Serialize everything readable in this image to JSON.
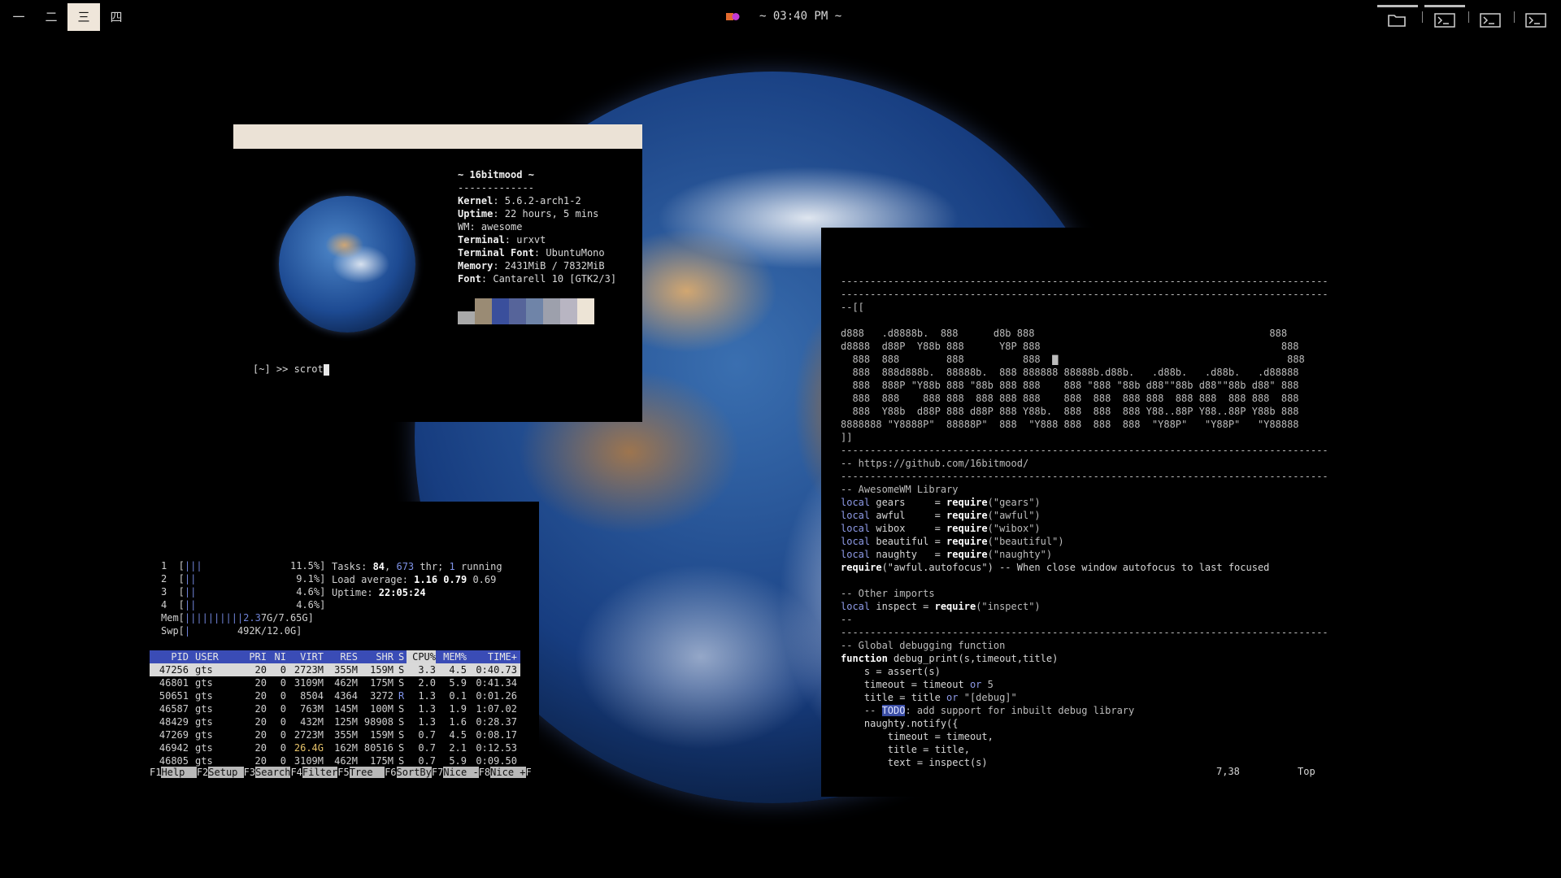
{
  "topbar": {
    "tags": [
      {
        "label": "一",
        "active": false
      },
      {
        "label": "二",
        "active": false
      },
      {
        "label": "三",
        "active": true
      },
      {
        "label": "四",
        "active": false
      }
    ],
    "clock": "~ 03:40 PM ~",
    "tasks": [
      "folder-icon",
      "terminal-icon",
      "terminal-icon",
      "terminal-icon"
    ],
    "colors": {
      "active_tag_bg": "#efe6da",
      "bar_bg": "#000000"
    }
  },
  "fetch": {
    "title": "~ 16bitmood ~",
    "rule": "-------------",
    "rows": [
      {
        "key": "Kernel",
        "value": ": 5.6.2-arch1-2"
      },
      {
        "key": "Uptime",
        "value": ": 22 hours, 5 mins"
      },
      {
        "key": "WM",
        "value": ": awesome"
      },
      {
        "key": "Terminal",
        "value": ": urxvt"
      },
      {
        "key": "Terminal Font",
        "value": ": UbuntuMono"
      },
      {
        "key": "Memory",
        "value": ": 2431MiB / 7832MiB"
      },
      {
        "key": "Font",
        "value": ": Cantarell 10 [GTK2/3]"
      }
    ],
    "palette": [
      "#a9a9a9",
      "#9a8b74",
      "#3a4f9c",
      "#56649a",
      "#6f84a8",
      "#9da0ac",
      "#b8b5c2",
      "#ede4d6"
    ],
    "prompt": "[~] >> scrot"
  },
  "htop": {
    "meters": [
      {
        "label": "1  [",
        "bar": "|||",
        "value": "11.5%]"
      },
      {
        "label": "2  [",
        "bar": "||",
        "value": "9.1%]"
      },
      {
        "label": "3  [",
        "bar": "||",
        "value": "4.6%]"
      },
      {
        "label": "4  [",
        "bar": "||",
        "value": "4.6%]"
      },
      {
        "label": "Mem[",
        "bar": "||||||||||2.3",
        "value": "7G/7.65G]"
      },
      {
        "label": "Swp[",
        "bar": "|",
        "value": "492K/12.0G]"
      }
    ],
    "tasks_label": "Tasks: ",
    "tasks": "84",
    "thr": "673",
    "thr_label": " thr; ",
    "running": "1",
    "running_label": " running",
    "load_label": "Load average: ",
    "load1": "1.16",
    "load5": "0.79",
    "load15": "0.69",
    "uptime_label": "Uptime: ",
    "uptime": "22:05:24",
    "columns": [
      "PID",
      "USER",
      "PRI",
      "NI",
      "VIRT",
      "RES",
      "SHR",
      "S",
      "CPU%",
      "MEM%",
      "TIME+"
    ],
    "processes": [
      {
        "pid": "47256",
        "user": "gts",
        "pri": "20",
        "ni": "0",
        "virt": "2723M",
        "res": "355M",
        "shr": "159M",
        "s": "S",
        "cpu": "3.3",
        "mem": "4.5",
        "time": "0:40.73"
      },
      {
        "pid": "46801",
        "user": "gts",
        "pri": "20",
        "ni": "0",
        "virt": "3109M",
        "res": "462M",
        "shr": "175M",
        "s": "S",
        "cpu": "2.0",
        "mem": "5.9",
        "time": "0:41.34"
      },
      {
        "pid": "50651",
        "user": "gts",
        "pri": "20",
        "ni": "0",
        "virt": "8504",
        "res": "4364",
        "shr": "3272",
        "s": "R",
        "cpu": "1.3",
        "mem": "0.1",
        "time": "0:01.26"
      },
      {
        "pid": "46587",
        "user": "gts",
        "pri": "20",
        "ni": "0",
        "virt": "763M",
        "res": "145M",
        "shr": "100M",
        "s": "S",
        "cpu": "1.3",
        "mem": "1.9",
        "time": "1:07.02"
      },
      {
        "pid": "48429",
        "user": "gts",
        "pri": "20",
        "ni": "0",
        "virt": "432M",
        "res": "125M",
        "shr": "98908",
        "s": "S",
        "cpu": "1.3",
        "mem": "1.6",
        "time": "0:28.37"
      },
      {
        "pid": "47269",
        "user": "gts",
        "pri": "20",
        "ni": "0",
        "virt": "2723M",
        "res": "355M",
        "shr": "159M",
        "s": "S",
        "cpu": "0.7",
        "mem": "4.5",
        "time": "0:08.17"
      },
      {
        "pid": "46942",
        "user": "gts",
        "pri": "20",
        "ni": "0",
        "virt": "26.4G",
        "res": "162M",
        "shr": "80516",
        "s": "S",
        "cpu": "0.7",
        "mem": "2.1",
        "time": "0:12.53"
      },
      {
        "pid": "46805",
        "user": "gts",
        "pri": "20",
        "ni": "0",
        "virt": "3109M",
        "res": "462M",
        "shr": "175M",
        "s": "S",
        "cpu": "0.7",
        "mem": "5.9",
        "time": "0:09.50"
      }
    ],
    "fkeys": [
      {
        "key": "F1",
        "label": "Help  "
      },
      {
        "key": "F2",
        "label": "Setup "
      },
      {
        "key": "F3",
        "label": "Search"
      },
      {
        "key": "F4",
        "label": "Filter"
      },
      {
        "key": "F5",
        "label": "Tree  "
      },
      {
        "key": "F6",
        "label": "SortBy"
      },
      {
        "key": "F7",
        "label": "Nice -"
      },
      {
        "key": "F8",
        "label": "Nice +"
      },
      {
        "key": "F",
        "label": ""
      }
    ]
  },
  "vim": {
    "lines": [
      {
        "segs": [
          {
            "t": "-----------------------------------------------------------------------------------",
            "c": "cm"
          }
        ]
      },
      {
        "segs": [
          {
            "t": "-----------------------------------------------------------------------------------",
            "c": "cm"
          }
        ]
      },
      {
        "segs": [
          {
            "t": "--[[",
            "c": "cm"
          }
        ]
      },
      {
        "segs": [
          {
            "t": "",
            "c": ""
          }
        ]
      },
      {
        "segs": [
          {
            "t": "d888   .d8888b.  888      d8b 888                                        888",
            "c": "cm"
          }
        ]
      },
      {
        "segs": [
          {
            "t": "d8888  d88P  Y88b 888      Y8P 888                                         888",
            "c": "cm"
          }
        ]
      },
      {
        "segs": [
          {
            "t": "  888  888        888          888  ",
            "c": "cm"
          },
          {
            "t": "▇",
            "c": "cm"
          },
          {
            "t": "                                       888",
            "c": "cm"
          }
        ]
      },
      {
        "segs": [
          {
            "t": "  888  888d888b.  88888b.  888 888888 88888b.d88b.   .d88b.   .d88b.   .d88888",
            "c": "cm"
          }
        ]
      },
      {
        "segs": [
          {
            "t": "  888  888P \"Y88b 888 \"88b 888 888    888 \"888 \"88b d88\"\"88b d88\"\"88b d88\" 888",
            "c": "cm"
          }
        ]
      },
      {
        "segs": [
          {
            "t": "  888  888    888 888  888 888 888    888  888  888 888  888 888  888 888  888",
            "c": "cm"
          }
        ]
      },
      {
        "segs": [
          {
            "t": "  888  Y88b  d88P 888 d88P 888 Y88b.  888  888  888 Y88..88P Y88..88P Y88b 888",
            "c": "cm"
          }
        ]
      },
      {
        "segs": [
          {
            "t": "8888888 \"Y8888P\"  88888P\"  888  \"Y888 888  888  888  \"Y88P\"   \"Y88P\"   \"Y88888",
            "c": "cm"
          }
        ]
      },
      {
        "segs": [
          {
            "t": "]]",
            "c": "cm"
          }
        ]
      },
      {
        "segs": [
          {
            "t": "-----------------------------------------------------------------------------------",
            "c": "cm"
          }
        ]
      },
      {
        "segs": [
          {
            "t": "-- https://github.com/16bitmood/",
            "c": "cm"
          }
        ]
      },
      {
        "segs": [
          {
            "t": "-----------------------------------------------------------------------------------",
            "c": "cm"
          }
        ]
      },
      {
        "segs": [
          {
            "t": "-- AwesomeWM Library",
            "c": "cm"
          }
        ]
      },
      {
        "segs": [
          {
            "t": "local",
            "c": "kw"
          },
          {
            "t": " gears     = ",
            "c": ""
          },
          {
            "t": "require",
            "c": "fn"
          },
          {
            "t": "(\"gears\")",
            "c": "str"
          }
        ]
      },
      {
        "segs": [
          {
            "t": "local",
            "c": "kw"
          },
          {
            "t": " awful     = ",
            "c": ""
          },
          {
            "t": "require",
            "c": "fn"
          },
          {
            "t": "(\"awful\")",
            "c": "str"
          }
        ]
      },
      {
        "segs": [
          {
            "t": "local",
            "c": "kw"
          },
          {
            "t": " wibox     = ",
            "c": ""
          },
          {
            "t": "require",
            "c": "fn"
          },
          {
            "t": "(\"wibox\")",
            "c": "str"
          }
        ]
      },
      {
        "segs": [
          {
            "t": "local",
            "c": "kw"
          },
          {
            "t": " beautiful = ",
            "c": ""
          },
          {
            "t": "require",
            "c": "fn"
          },
          {
            "t": "(\"beautiful\")",
            "c": "str"
          }
        ]
      },
      {
        "segs": [
          {
            "t": "local",
            "c": "kw"
          },
          {
            "t": " naughty   = ",
            "c": ""
          },
          {
            "t": "require",
            "c": "fn"
          },
          {
            "t": "(\"naughty\")",
            "c": "str"
          }
        ]
      },
      {
        "segs": [
          {
            "t": "require",
            "c": "fn"
          },
          {
            "t": "(\"awful.autofocus\") -- When close window autofocus to last focused",
            "c": ""
          }
        ]
      },
      {
        "segs": [
          {
            "t": "",
            "c": ""
          }
        ]
      },
      {
        "segs": [
          {
            "t": "-- Other imports",
            "c": "cm"
          }
        ]
      },
      {
        "segs": [
          {
            "t": "local",
            "c": "kw"
          },
          {
            "t": " inspect = ",
            "c": ""
          },
          {
            "t": "require",
            "c": "fn"
          },
          {
            "t": "(\"inspect\")",
            "c": "str"
          }
        ]
      },
      {
        "segs": [
          {
            "t": "--",
            "c": "cm"
          }
        ]
      },
      {
        "segs": [
          {
            "t": "-----------------------------------------------------------------------------------",
            "c": "cm"
          }
        ]
      },
      {
        "segs": [
          {
            "t": "-- Global debugging function",
            "c": "cm"
          }
        ]
      },
      {
        "segs": [
          {
            "t": "function",
            "c": "fn"
          },
          {
            "t": " debug_print(s,timeout,title)",
            "c": ""
          }
        ]
      },
      {
        "segs": [
          {
            "t": "    s = assert(s)",
            "c": ""
          }
        ]
      },
      {
        "segs": [
          {
            "t": "    timeout = timeout ",
            "c": ""
          },
          {
            "t": "or",
            "c": "kw"
          },
          {
            "t": " 5",
            "c": "str"
          }
        ]
      },
      {
        "segs": [
          {
            "t": "    title = title ",
            "c": ""
          },
          {
            "t": "or",
            "c": "kw"
          },
          {
            "t": " \"[debug]\"",
            "c": "str"
          }
        ]
      },
      {
        "segs": [
          {
            "t": "    -- ",
            "c": "cm"
          },
          {
            "t": "TODO",
            "c": "todo"
          },
          {
            "t": ": add support for inbuilt debug library",
            "c": "cm"
          }
        ]
      },
      {
        "segs": [
          {
            "t": "    naughty.notify({",
            "c": ""
          }
        ]
      },
      {
        "segs": [
          {
            "t": "        timeout = timeout,",
            "c": ""
          }
        ]
      },
      {
        "segs": [
          {
            "t": "        title = title,",
            "c": ""
          }
        ]
      },
      {
        "segs": [
          {
            "t": "        text = inspect(s)",
            "c": ""
          }
        ]
      }
    ],
    "status_pos": "7,38",
    "status_scroll": "Top"
  }
}
